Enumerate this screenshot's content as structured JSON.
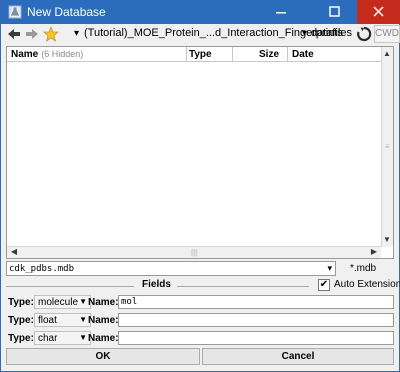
{
  "window": {
    "title": "New Database",
    "app_icon": "flask-icon",
    "minimize_icon": "minimize-icon",
    "maximize_icon": "maximize-icon",
    "close_icon": "close-icon"
  },
  "toolbar": {
    "back_icon": "arrow-left-icon",
    "forward_icon": "arrow-right-icon",
    "favorites_icon": "star-icon",
    "path_dropdown": "▾",
    "path": "(Tutorial)_MOE_Protein_...d_Interaction_Fingerprints",
    "subfolder_dropdown": "▾",
    "subfolder": "datafiles",
    "refresh_icon": "refresh-icon",
    "cwd_label": "CWD"
  },
  "file_list": {
    "columns": [
      {
        "label": "Name"
      },
      {
        "label": "Type"
      },
      {
        "label": "Size"
      },
      {
        "label": "Date"
      }
    ],
    "hidden_count": "(6 Hidden)",
    "rows": []
  },
  "filename": {
    "value": "cdk_pdbs.mdb",
    "extension": "*.mdb",
    "dropdown": "▾"
  },
  "fields": {
    "title": "Fields",
    "auto_extension": {
      "label": "Auto Extension",
      "checked": true
    },
    "type_label": "Type:",
    "name_label": "Name:",
    "rows": [
      {
        "type": "molecule",
        "name": "mol"
      },
      {
        "type": "float",
        "name": ""
      },
      {
        "type": "char",
        "name": ""
      }
    ]
  },
  "buttons": {
    "ok": "OK",
    "cancel": "Cancel"
  },
  "colors": {
    "titlebar": "#2b6cbd",
    "close_hover": "#c42b1c",
    "dialog_bg": "#f0f0f0"
  }
}
